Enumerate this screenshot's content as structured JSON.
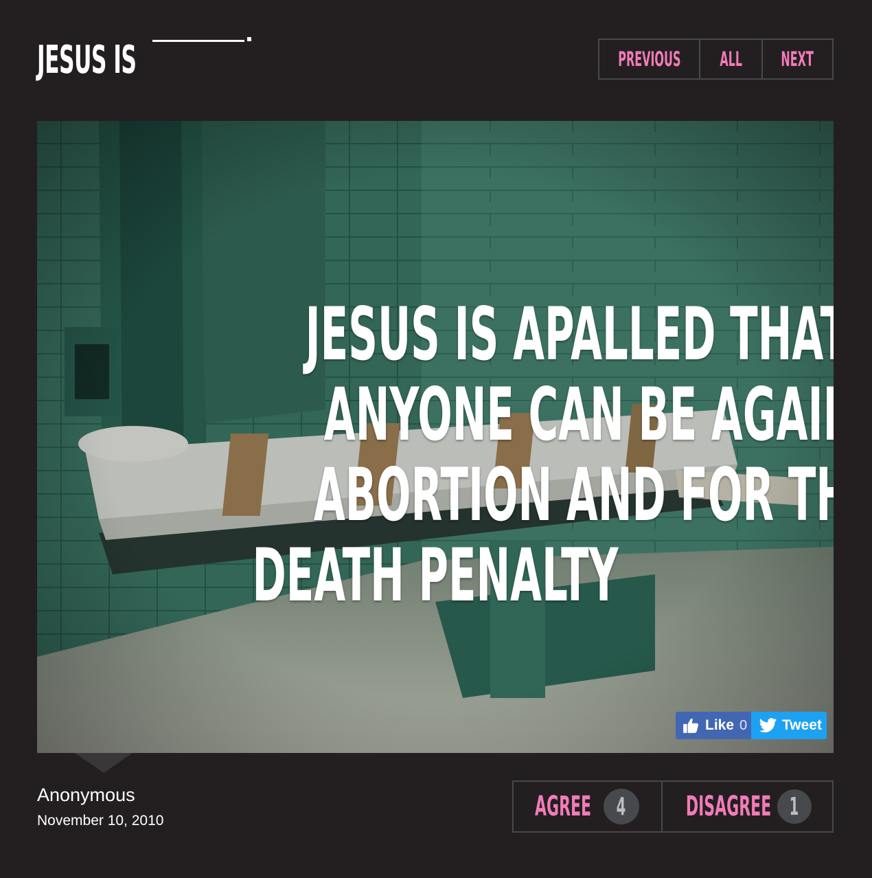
{
  "header": {
    "logo_text": "JESUS IS",
    "nav": {
      "previous_label": "PREVIOUS",
      "all_label": "ALL",
      "next_label": "NEXT"
    }
  },
  "post": {
    "quote_lines": [
      "JESUS IS APALLED THAT",
      "ANYONE CAN BE AGAINST",
      "ABORTION AND FOR THE",
      "DEATH PENALTY"
    ],
    "social": {
      "like_label": "Like",
      "like_count": "0",
      "tweet_label": "Tweet"
    },
    "author": "Anonymous",
    "date": "November 10, 2010",
    "votes": {
      "agree_label": "AGREE",
      "agree_count": "4",
      "disagree_label": "DISAGREE",
      "disagree_count": "1"
    }
  },
  "colors": {
    "background": "#231f20",
    "accent_pink": "#f27bb9",
    "border_gray": "#47494c",
    "facebook_blue": "#4267b2",
    "twitter_blue": "#1da1f2"
  },
  "icons": {
    "like": "thumbs-up-icon",
    "tweet": "twitter-bird-icon"
  }
}
